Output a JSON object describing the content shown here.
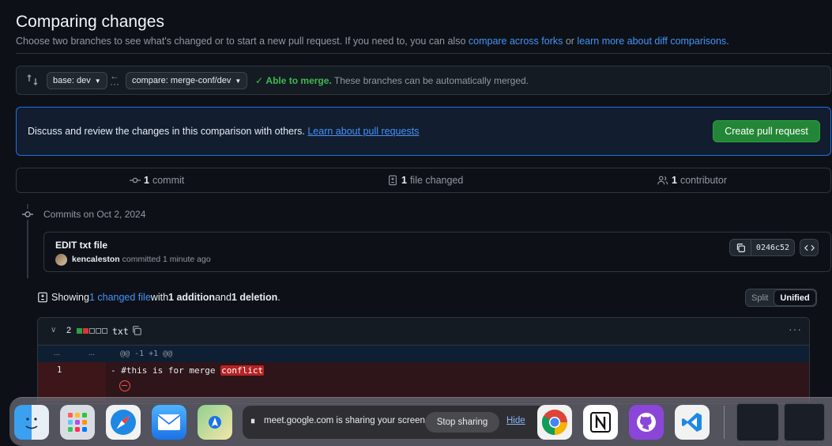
{
  "header": {
    "title": "Comparing changes",
    "subtitle_prefix": "Choose two branches to see what's changed or to start a new pull request. If you need to, you can also ",
    "link_compare_forks": "compare across forks",
    "subtitle_or": " or ",
    "link_learn_diff": "learn more about diff comparisons",
    "subtitle_suffix": "."
  },
  "range": {
    "base_label": "base: dev",
    "compare_label": "compare: merge-conf/dev",
    "merge_status": "Able to merge.",
    "merge_detail": " These branches can be automatically merged."
  },
  "pr_prompt": {
    "message": "Discuss and review the changes in this comparison with others. ",
    "learn_link": "Learn about pull requests",
    "create_button": "Create pull request"
  },
  "stats": {
    "commits_count": "1",
    "commits_label": "commit",
    "files_count": "1",
    "files_label": "file changed",
    "contributors_count": "1",
    "contributors_label": "contributor"
  },
  "commits": {
    "date_heading": "Commits on Oct 2, 2024",
    "items": [
      {
        "title": "EDIT txt file",
        "author": "kencaleston",
        "meta": " committed 1 minute ago",
        "sha": "0246c52"
      }
    ]
  },
  "summary": {
    "prefix": "Showing ",
    "changed_link": "1 changed file",
    "with": " with ",
    "additions": "1 addition",
    "and": " and ",
    "deletions": "1 deletion",
    "suffix": "."
  },
  "view_toggle": {
    "split": "Split",
    "unified": "Unified",
    "selected": "Unified"
  },
  "diff": {
    "file_change_count": "2",
    "file_name": "txt",
    "hunk_left": "...",
    "hunk_right": "...",
    "hunk_header": "@@ -1 +1 @@",
    "deleted_line_number": "1",
    "deleted_prefix": "- #this is for merge ",
    "deleted_highlight": "conflict",
    "colors": {
      "add": "#2ea043",
      "del": "#da3633",
      "neutral": "#3d444d"
    }
  },
  "screen_share": {
    "text": "meet.google.com is sharing your screen.",
    "stop_button": "Stop sharing",
    "hide_button": "Hide"
  },
  "dock": {
    "apps": [
      "finder-icon",
      "launchpad-icon",
      "safari-icon",
      "mail-icon",
      "maps-icon",
      "chrome-icon",
      "notion-icon",
      "github-desktop-icon",
      "vscode-icon"
    ]
  }
}
